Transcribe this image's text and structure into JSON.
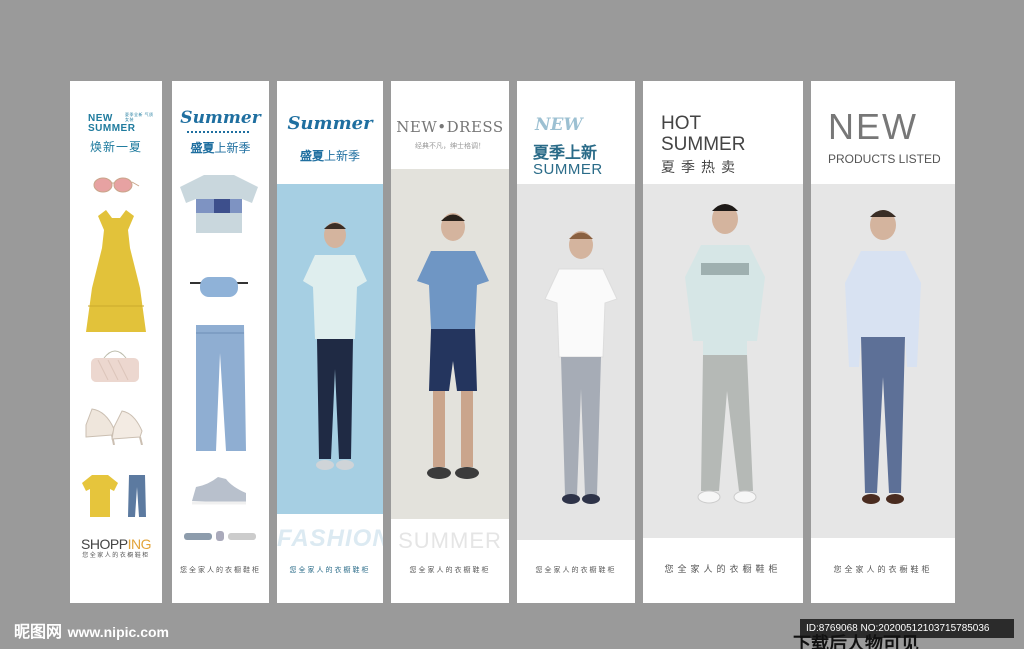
{
  "panels": [
    {
      "heading_en": "NEW SUMMER",
      "heading_small": "夏季全新 气质女装",
      "heading_cn": "焕新一夏",
      "shopping_a": "SHOPP",
      "shopping_b": "ING",
      "footer": "您全家人的衣橱鞋柜"
    },
    {
      "title": "Summer",
      "cn_a": "盛夏",
      "cn_b": "上新季",
      "footer": "您全家人的衣橱鞋柜"
    },
    {
      "title": "Summer",
      "cn_a": "盛夏",
      "cn_b": "上新季",
      "bottom_word": "FASHION",
      "footer": "您全家人的衣橱鞋柜"
    },
    {
      "title": "NEW•DRESS",
      "subtitle": "经典不凡，绅士格调！",
      "bottom_word": "SUMMER",
      "footer": "您全家人的衣橱鞋柜"
    },
    {
      "new": "NEW",
      "cn": "夏季上新",
      "en": "SUMMER",
      "footer": "您全家人的衣橱鞋柜"
    },
    {
      "hot": "HOT",
      "summer": "SUMMER",
      "cn": "夏季热卖",
      "footer": "您全家人的衣橱鞋柜"
    },
    {
      "new": "NEW",
      "en": "PRODUCTS LISTED",
      "footer": "您全家人的衣橱鞋柜"
    }
  ],
  "watermark": {
    "site_cn": "昵图网",
    "site_url": "www.nipic.com",
    "id_text": "ID:8769068 NO:20200512103715785036",
    "download_note": "下载后人物可见"
  },
  "colors": {
    "background": "#9a9a9a",
    "accent_blue": "#1f6fa0",
    "dress_yellow": "#e2c23a"
  }
}
